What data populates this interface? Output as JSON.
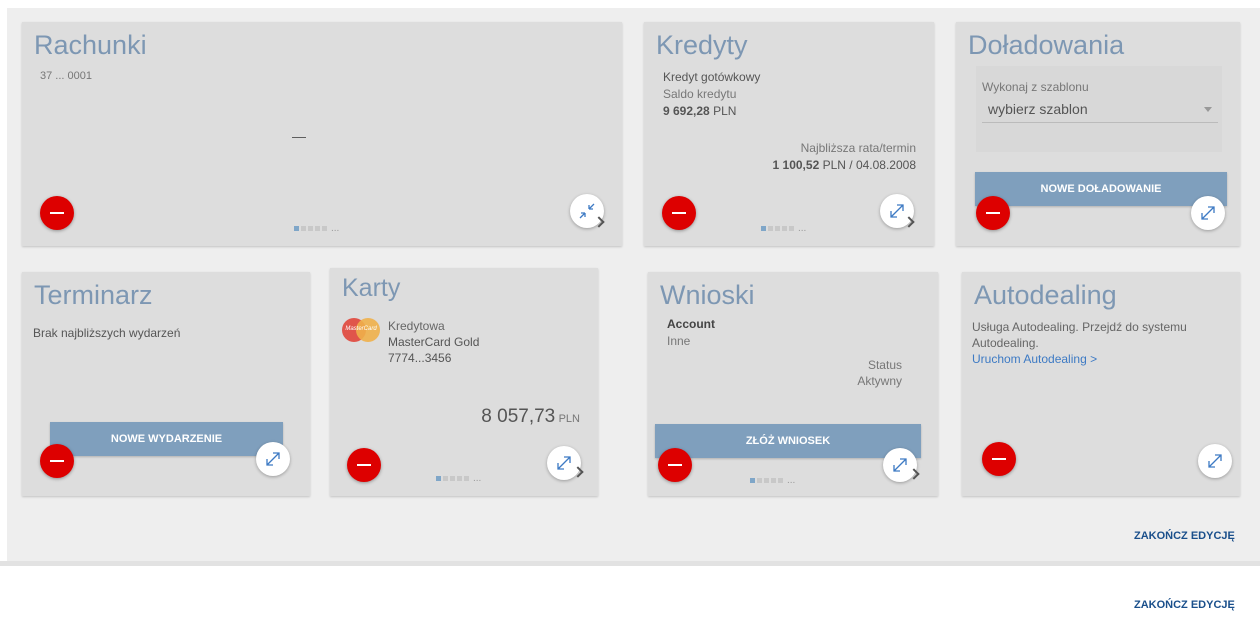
{
  "rachunki": {
    "title": "Rachunki",
    "account": "37 ... 0001",
    "value": "—",
    "pager_more": "..."
  },
  "kredyty": {
    "title": "Kredyty",
    "loan_type": "Kredyt gotówkowy",
    "balance_label": "Saldo kredytu",
    "balance_amount": "9 692,28",
    "balance_currency": "PLN",
    "next_rate_label": "Najbliższa rata/termin",
    "next_rate_amount": "1 100,52",
    "next_rate_rest": "PLN / 04.08.2008",
    "pager_more": "..."
  },
  "doladowania": {
    "title": "Doładowania",
    "template_label": "Wykonaj z szablonu",
    "template_value": "wybierz szablon",
    "button": "NOWE DOŁADOWANIE"
  },
  "terminarz": {
    "title": "Terminarz",
    "empty": "Brak najbliższych wydarzeń",
    "button": "NOWE WYDARZENIE"
  },
  "karty": {
    "title": "Karty",
    "card_type": "Kredytowa",
    "card_name": "MasterCard Gold",
    "card_number": "7774...3456",
    "card_logo_text": "MasterCard",
    "amount": "8 057,73",
    "currency": "PLN",
    "pager_more": "..."
  },
  "wnioski": {
    "title": "Wnioski",
    "name": "Account",
    "category": "Inne",
    "status_label": "Status",
    "status_value": "Aktywny",
    "button": "ZŁÓŻ WNIOSEK",
    "pager_more": "..."
  },
  "autodealing": {
    "title": "Autodealing",
    "desc_line1": "Usługa Autodealing. Przejdź do systemu",
    "desc_line2": "Autodealing.",
    "link": "Uruchom Autodealing >"
  },
  "footer": {
    "finish_edit": "ZAKOŃCZ EDYCJĘ"
  },
  "colors": {
    "title": "#7d97b3",
    "remove": "#dd0000",
    "action": "#7f9fbd",
    "link": "#3d7ac4",
    "tile_bg": "#dddddd"
  }
}
